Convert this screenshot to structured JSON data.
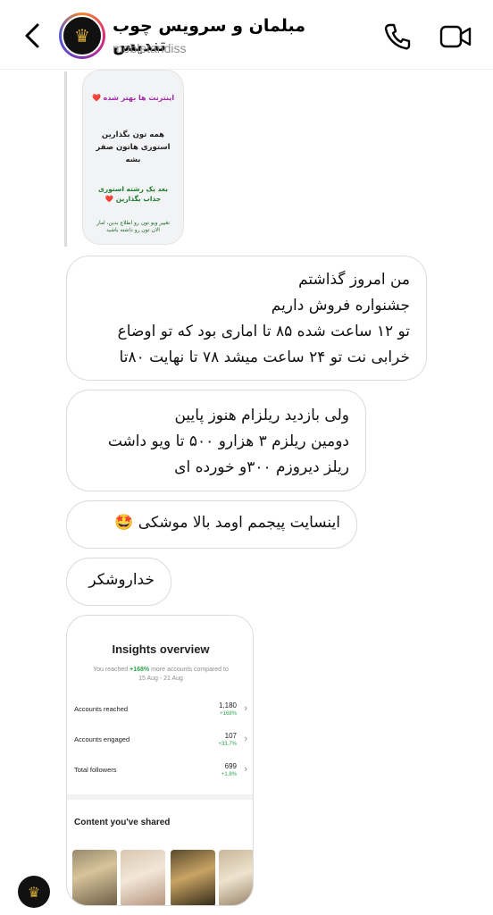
{
  "header": {
    "title": "مبلمان و سرویس چوب تندیس",
    "handle": "mobletandiss",
    "avatar_icon": "logo-crown-icon",
    "back_icon": "chevron-left-icon",
    "call_icon": "phone-icon",
    "video_icon": "video-camera-icon"
  },
  "story": {
    "line1": "اینترنت ها بهتر شده ❤️",
    "line2": "همه تون بگذارین استوری هاتون صفر بشه",
    "line3": "بعد یک رشته استوری جذاب بگذارین ❤️",
    "line4": "تغییر ویو تون رو اطلاع بدین، امار الان تون رو داشته باشید"
  },
  "messages": [
    {
      "lines": [
        "من امروز گذاشتم",
        "جشنواره فروش داریم",
        "تو ۱۲ ساعت شده ۸۵ تا اماری بود که تو اوضاع",
        "خرابی نت تو ۲۴ ساعت میشد ۷۸ تا نهایت ۸۰تا"
      ]
    },
    {
      "lines": [
        "ولی بازدید ریلزام هنوز پایین",
        "دومین ریلزم ۳ هزارو ۵۰۰ تا ویو داشت",
        "ریلز دیروزم ۳۰۰و خورده ای"
      ]
    },
    {
      "lines": [
        "اینسایت پیجمم اومد بالا موشکی 🤩"
      ]
    },
    {
      "lines": [
        "خداروشکر"
      ]
    }
  ],
  "insights": {
    "title": "Insights overview",
    "sub_prefix": "You reached",
    "sub_pct": "+168%",
    "sub_suffix": "more accounts compared to",
    "sub_range": "15 Aug - 21 Aug",
    "rows": [
      {
        "label": "Accounts reached",
        "value": "1,180",
        "change": "+168%"
      },
      {
        "label": "Accounts engaged",
        "value": "107",
        "change": "+33.7%"
      },
      {
        "label": "Total followers",
        "value": "699",
        "change": "+1.8%"
      }
    ],
    "shared_title": "Content you've shared"
  }
}
